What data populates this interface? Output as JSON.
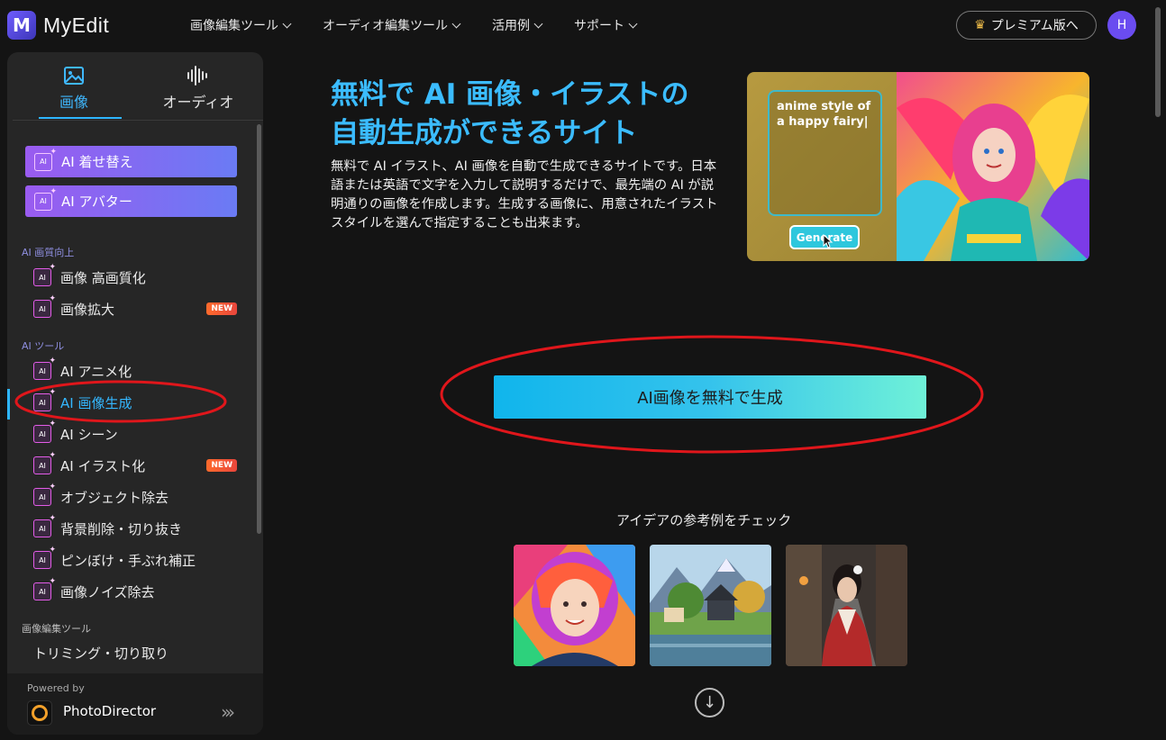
{
  "header": {
    "logo_text": "MyEdit",
    "logo_letter": "M",
    "nav": [
      "画像編集ツール",
      "オーディオ編集ツール",
      "活用例",
      "サポート"
    ],
    "premium_label": "プレミアム版へ",
    "avatar_initial": "H"
  },
  "sidebar": {
    "tabs": [
      {
        "label": "画像",
        "icon": "image-icon",
        "active": true
      },
      {
        "label": "オーディオ",
        "icon": "audio-wave-icon",
        "active": false
      }
    ],
    "featured": [
      "AI 着せ替え",
      "AI アバター"
    ],
    "sections": [
      {
        "title": "AI 画質向上",
        "items": [
          {
            "label": "画像 高画質化"
          },
          {
            "label": "画像拡大",
            "badge": "NEW"
          }
        ]
      },
      {
        "title": "AI ツール",
        "items": [
          {
            "label": "AI アニメ化"
          },
          {
            "label": "AI 画像生成",
            "active": true
          },
          {
            "label": "AI シーン"
          },
          {
            "label": "AI イラスト化",
            "badge": "NEW"
          },
          {
            "label": "オブジェクト除去"
          },
          {
            "label": "背景削除・切り抜き"
          },
          {
            "label": "ピンぼけ・手ぶれ補正"
          },
          {
            "label": "画像ノイズ除去"
          }
        ]
      },
      {
        "title": "画像編集ツール",
        "items": [
          {
            "label": "トリミング・切り取り"
          }
        ]
      }
    ],
    "ai_icon_text": "AI",
    "powered_by": "Powered by",
    "product_name": "PhotoDirector"
  },
  "hero": {
    "title_line1": "無料で AI 画像・イラストの",
    "title_line2": "自動生成ができるサイト",
    "description": "無料で AI イラスト、AI 画像を自動で生成できるサイトです。日本語または英語で文字を入力して説明するだけで、最先端の AI が説明通りの画像を作成します。生成する画像に、用意されたイラストスタイルを選んで指定することも出来ます。",
    "prompt_text": "anime style of a happy fairy|",
    "generate_label": "Generate"
  },
  "cta": {
    "label": "AI画像を無料で生成"
  },
  "ideas": {
    "title": "アイデアの参考例をチェック",
    "thumbnails": [
      "colorful-anime-girl",
      "mountain-house-landscape",
      "kimono-woman-street"
    ]
  },
  "colors": {
    "accent": "#34b7ff",
    "annotation": "#e0161b",
    "background": "#141414",
    "sidebar": "#262626"
  }
}
